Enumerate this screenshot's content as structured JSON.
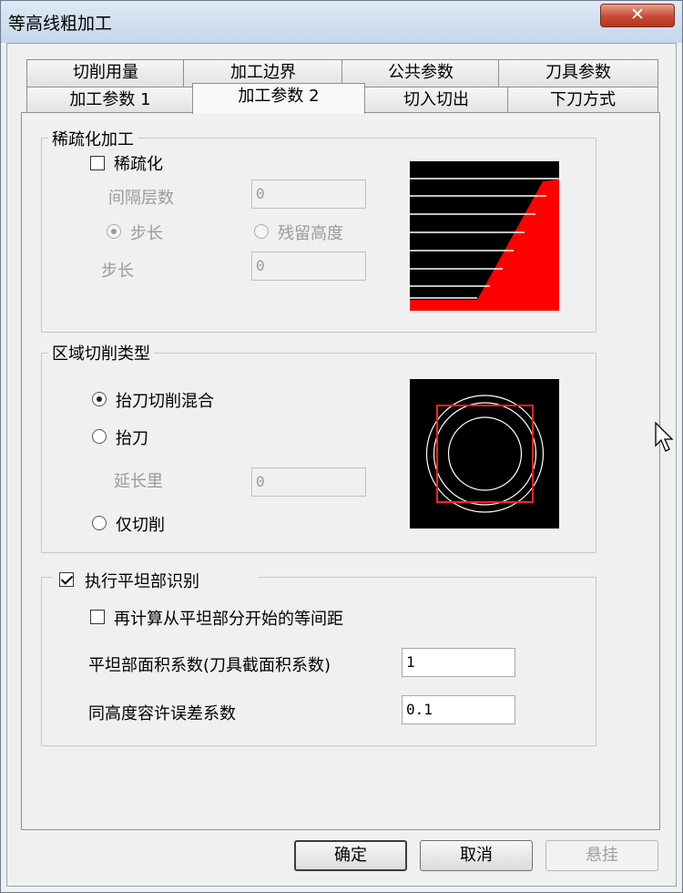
{
  "window": {
    "title": "等高线粗加工",
    "close_label": "✕"
  },
  "tabs_row_top": [
    "切削用量",
    "加工边界",
    "公共参数",
    "刀具参数"
  ],
  "tabs_row_bottom": [
    "加工参数 1",
    "加工参数 2",
    "切入切出",
    "下刀方式"
  ],
  "active_tab": "加工参数 2",
  "sparse_group": {
    "title": "稀疏化加工",
    "checkbox_label": "稀疏化",
    "checked": false,
    "interval_label": "间隔层数",
    "interval_value": "0",
    "radio_step_label": "步长",
    "radio_residual_label": "残留高度",
    "step_label": "步长",
    "step_value": "0"
  },
  "region_group": {
    "title": "区域切削类型",
    "option_mixed": "抬刀切削混合",
    "option_lift": "抬刀",
    "extend_label": "延长里",
    "extend_value": "0",
    "option_cut_only": "仅切削",
    "selected": "抬刀切削混合"
  },
  "flat_group": {
    "title": "执行平坦部识别",
    "checked": true,
    "recalc_label": "再计算从平坦部分开始的等间距",
    "recalc_checked": false,
    "area_coef_label": "平坦部面积系数(刀具截面积系数)",
    "area_coef_value": "1",
    "height_tol_label": "同高度容许误差系数",
    "height_tol_value": "0.1"
  },
  "buttons": {
    "ok": "确定",
    "cancel": "取消",
    "suspend": "悬挂"
  },
  "colors": {
    "preview_bg": "#000000",
    "accent_red": "#ff0000",
    "line_white": "#ffffff"
  }
}
